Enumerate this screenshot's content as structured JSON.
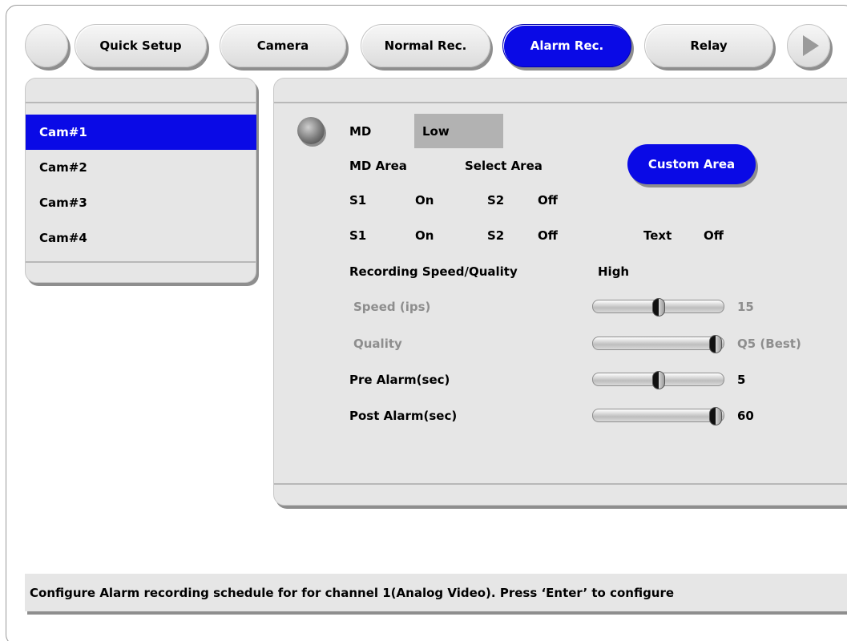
{
  "tabs": [
    {
      "label": "Quick Setup",
      "active": false
    },
    {
      "label": "Camera",
      "active": false
    },
    {
      "label": "Normal Rec.",
      "active": false
    },
    {
      "label": "Alarm Rec.",
      "active": true
    },
    {
      "label": "Relay",
      "active": false
    }
  ],
  "cameras": [
    {
      "label": "Cam#1",
      "selected": true
    },
    {
      "label": "Cam#2",
      "selected": false
    },
    {
      "label": "Cam#3",
      "selected": false
    },
    {
      "label": "Cam#4",
      "selected": false
    }
  ],
  "settings": {
    "md_label": "MD",
    "md_value": "Low",
    "md_area_label": "MD Area",
    "md_area_value": "Select Area",
    "custom_area_button": "Custom Area",
    "row1": {
      "s1_label": "S1",
      "s1_value": "On",
      "s2_label": "S2",
      "s2_value": "Off"
    },
    "row2": {
      "s1_label": "S1",
      "s1_value": "On",
      "s2_label": "S2",
      "s2_value": "Off",
      "text_label": "Text",
      "text_value": "Off"
    },
    "recording_label": "Recording Speed/Quality",
    "recording_value": "High",
    "speed": {
      "label": "Speed (ips)",
      "value": "15",
      "level": 0.5,
      "enabled": false
    },
    "quality": {
      "label": "Quality",
      "value": "Q5 (Best)",
      "level": 1.0,
      "enabled": false
    },
    "pre_alarm": {
      "label": "Pre Alarm(sec)",
      "value": "5",
      "level": 0.5,
      "enabled": true
    },
    "post_alarm": {
      "label": "Post Alarm(sec)",
      "value": "60",
      "level": 1.0,
      "enabled": true
    }
  },
  "status_text": "Configure Alarm recording schedule for for channel 1(Analog Video). Press ‘Enter’ to configure",
  "colors": {
    "accent": "#0a0ae6",
    "panel": "#e6e6e6",
    "disabled_text": "#8e8e8e"
  }
}
